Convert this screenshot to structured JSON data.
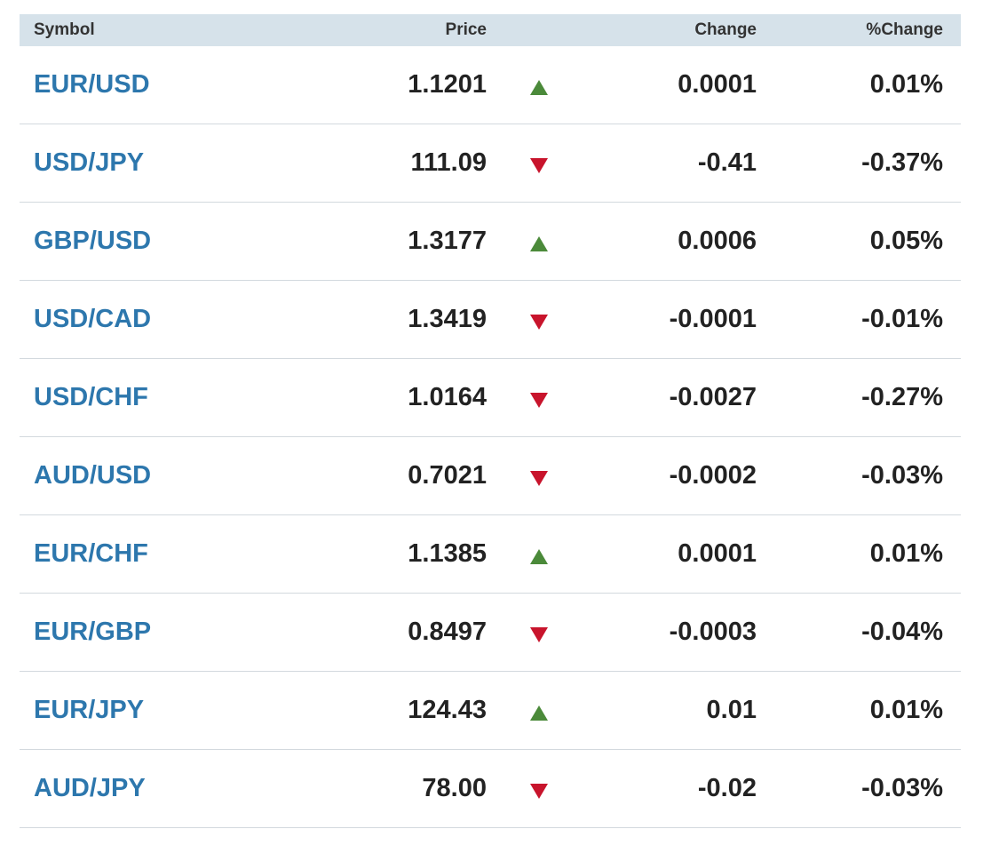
{
  "header": {
    "symbol": "Symbol",
    "price": "Price",
    "change": "Change",
    "pct_change": "%Change"
  },
  "colors": {
    "header_bg": "#d6e2ea",
    "symbol_link": "#2d77ad",
    "up": "#4b8a3a",
    "down": "#c8142c"
  },
  "rows": [
    {
      "symbol": "EUR/USD",
      "price": "1.1201",
      "direction": "up",
      "change": "0.0001",
      "pct": "0.01%"
    },
    {
      "symbol": "USD/JPY",
      "price": "111.09",
      "direction": "down",
      "change": "-0.41",
      "pct": "-0.37%"
    },
    {
      "symbol": "GBP/USD",
      "price": "1.3177",
      "direction": "up",
      "change": "0.0006",
      "pct": "0.05%"
    },
    {
      "symbol": "USD/CAD",
      "price": "1.3419",
      "direction": "down",
      "change": "-0.0001",
      "pct": "-0.01%"
    },
    {
      "symbol": "USD/CHF",
      "price": "1.0164",
      "direction": "down",
      "change": "-0.0027",
      "pct": "-0.27%"
    },
    {
      "symbol": "AUD/USD",
      "price": "0.7021",
      "direction": "down",
      "change": "-0.0002",
      "pct": "-0.03%"
    },
    {
      "symbol": "EUR/CHF",
      "price": "1.1385",
      "direction": "up",
      "change": "0.0001",
      "pct": "0.01%"
    },
    {
      "symbol": "EUR/GBP",
      "price": "0.8497",
      "direction": "down",
      "change": "-0.0003",
      "pct": "-0.04%"
    },
    {
      "symbol": "EUR/JPY",
      "price": "124.43",
      "direction": "up",
      "change": "0.01",
      "pct": "0.01%"
    },
    {
      "symbol": "AUD/JPY",
      "price": "78.00",
      "direction": "down",
      "change": "-0.02",
      "pct": "-0.03%"
    }
  ]
}
